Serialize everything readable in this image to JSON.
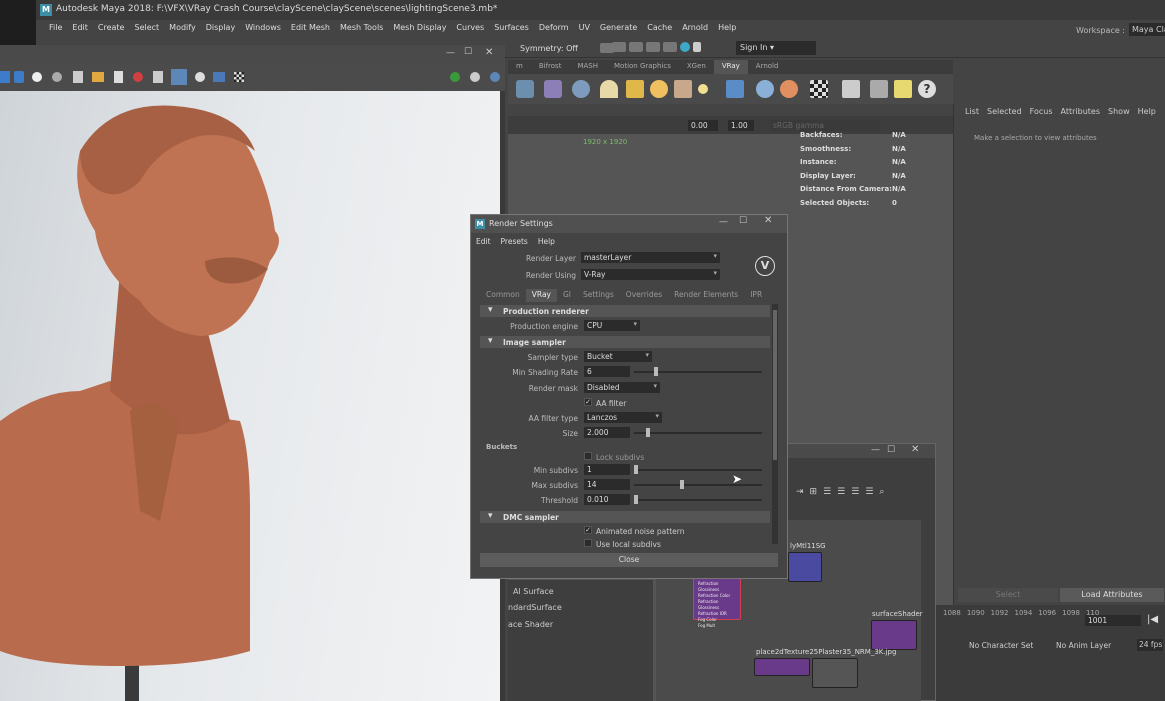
{
  "maya": {
    "title": "Autodesk Maya 2018: F:\\VFX\\VRay Crash Course\\clayScene\\clayScene\\scenes\\lightingScene3.mb*",
    "menu": [
      "File",
      "Edit",
      "Create",
      "Select",
      "Modify",
      "Display",
      "Windows",
      "Edit Mesh",
      "Mesh Tools",
      "Mesh Display",
      "Curves",
      "Surfaces",
      "Deform",
      "UV",
      "Generate",
      "Cache",
      "Arnold",
      "Help"
    ],
    "workspace_label": "Workspace :",
    "workspace_value": "Maya Classic",
    "symmetry": "Symmetry: Off",
    "sign_in": "Sign In",
    "shelf_tabs": [
      "m",
      "Bifrost",
      "MASH",
      "Motion Graphics",
      "XGen",
      "VRay",
      "Arnold"
    ],
    "active_shelf": "VRay",
    "viewport": {
      "gamma_field": "0.00",
      "exposure_field": "1.00",
      "color_space": "sRGB gamma",
      "resolution": "1920 x 1920"
    }
  },
  "headsup": {
    "rows": [
      {
        "label": "Backfaces:",
        "value": "N/A"
      },
      {
        "label": "Smoothness:",
        "value": "N/A"
      },
      {
        "label": "Instance:",
        "value": "N/A"
      },
      {
        "label": "Display Layer:",
        "value": "N/A"
      },
      {
        "label": "Distance From Camera:",
        "value": "N/A"
      },
      {
        "label": "Selected Objects:",
        "value": "0"
      }
    ]
  },
  "attribute_editor": {
    "menu": [
      "List",
      "Selected",
      "Focus",
      "Attributes",
      "Show",
      "Help"
    ],
    "message": "Make a selection to view attributes",
    "select_button": "Select",
    "load_button": "Load Attributes"
  },
  "timeline": {
    "ticks": [
      "1088",
      "1090",
      "1092",
      "1094",
      "1096",
      "1098",
      "110"
    ],
    "frame": "1001",
    "character_set": "No Character Set",
    "anim_layer": "No Anim Layer",
    "fps": "24 fps"
  },
  "render_settings": {
    "title": "Render Settings",
    "menu": [
      "Edit",
      "Presets",
      "Help"
    ],
    "render_layer_label": "Render Layer",
    "render_layer_value": "masterLayer",
    "render_using_label": "Render Using",
    "render_using_value": "V-Ray",
    "tabs": [
      "Common",
      "VRay",
      "GI",
      "Settings",
      "Overrides",
      "Render Elements",
      "IPR"
    ],
    "active_tab": "VRay",
    "production_renderer": {
      "header": "Production renderer",
      "engine_label": "Production engine",
      "engine_value": "CPU"
    },
    "image_sampler": {
      "header": "Image sampler",
      "sampler_type_label": "Sampler type",
      "sampler_type_value": "Bucket",
      "min_shading_label": "Min Shading Rate",
      "min_shading_value": "6",
      "render_mask_label": "Render mask",
      "render_mask_value": "Disabled",
      "aa_filter_label": "AA filter",
      "aa_filter_checked": true,
      "aa_filter_type_label": "AA filter type",
      "aa_filter_type_value": "Lanczos",
      "size_label": "Size",
      "size_value": "2.000"
    },
    "buckets": {
      "header": "Buckets",
      "lock_subdivs_label": "Lock subdivs",
      "lock_subdivs_checked": false,
      "min_subdivs_label": "Min subdivs",
      "min_subdivs_value": "1",
      "max_subdivs_label": "Max subdivs",
      "max_subdivs_value": "14",
      "threshold_label": "Threshold",
      "threshold_value": "0.010"
    },
    "dmc_sampler": {
      "header": "DMC sampler",
      "animated_noise_label": "Animated noise pattern",
      "animated_noise_checked": true,
      "local_subdivs_label": "Use local subdivs",
      "local_subdivs_checked": false
    },
    "close_button": "Close"
  },
  "hypershade": {
    "list_items": [
      "Al Surface",
      "ndardSurface",
      "ace Shader"
    ],
    "nodes": {
      "mtl_sg": "lyMtl11SG",
      "surface_shader": "surfaceShader",
      "texture": "place2dTexture25Plaster35_NRM_3K.jpg"
    },
    "mtl_attrs": [
      "Refraction Glossiness",
      "Refraction Color",
      "Refraction Glossiness",
      "Refraction IOR",
      "Fog Color",
      "Fog Mult"
    ]
  }
}
